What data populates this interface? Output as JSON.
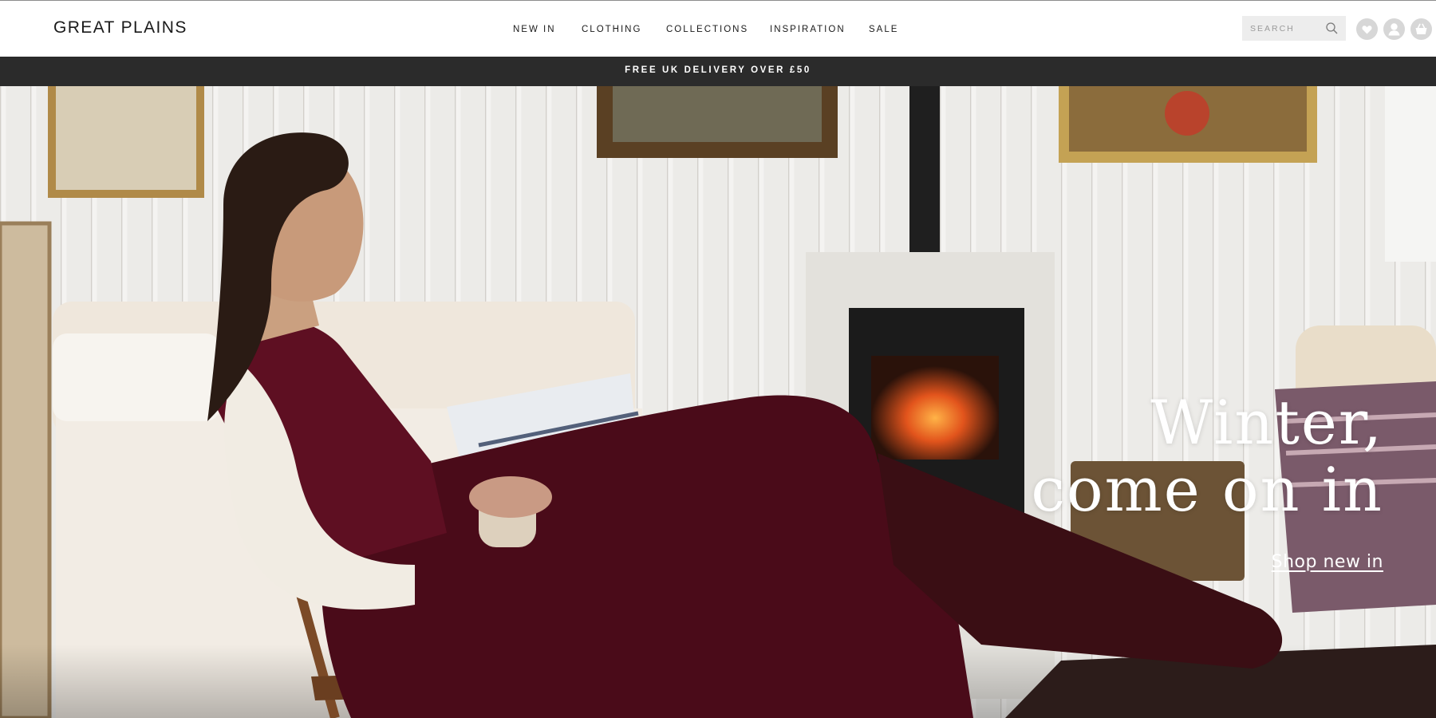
{
  "brand": {
    "logo": "GREAT PLAINS"
  },
  "nav": {
    "items": [
      {
        "label": "NEW IN"
      },
      {
        "label": "CLOTHING"
      },
      {
        "label": "COLLECTIONS"
      },
      {
        "label": "INSPIRATION"
      },
      {
        "label": "SALE"
      }
    ]
  },
  "search": {
    "placeholder": "SEARCH",
    "value": "",
    "icon": "search-icon"
  },
  "header_icons": [
    {
      "name": "wishlist-heart-icon",
      "color": "#d7d7d7"
    },
    {
      "name": "account-user-icon",
      "color": "#d7d7d7"
    },
    {
      "name": "shopping-basket-icon",
      "color": "#d7d7d7"
    }
  ],
  "promo": {
    "text": "FREE UK DELIVERY OVER £50",
    "background": "#2b2b2b"
  },
  "hero": {
    "headline_line1": "Winter,",
    "headline_line2": "come on in",
    "cta_label": "Shop new in"
  },
  "colors": {
    "text_dark": "#1a1a1a",
    "accent_burgundy": "#5e0f22",
    "search_bg": "#ededed"
  }
}
